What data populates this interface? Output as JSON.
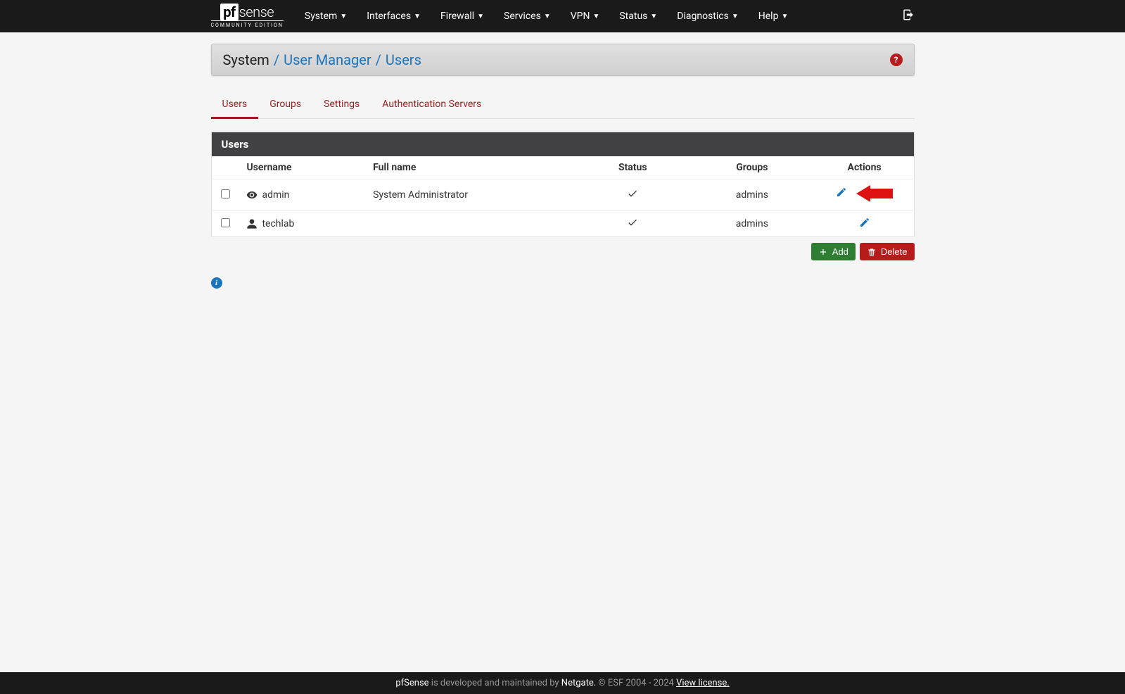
{
  "logo": {
    "brand": "sense",
    "prefix": "pf",
    "subtitle": "COMMUNITY EDITION"
  },
  "nav": {
    "items": [
      {
        "label": "System"
      },
      {
        "label": "Interfaces"
      },
      {
        "label": "Firewall"
      },
      {
        "label": "Services"
      },
      {
        "label": "VPN"
      },
      {
        "label": "Status"
      },
      {
        "label": "Diagnostics"
      },
      {
        "label": "Help"
      }
    ]
  },
  "breadcrumb": {
    "part1": "System",
    "part2": "User Manager",
    "part3": "Users",
    "sep": "/"
  },
  "tabs": [
    {
      "label": "Users",
      "active": true
    },
    {
      "label": "Groups",
      "active": false
    },
    {
      "label": "Settings",
      "active": false
    },
    {
      "label": "Authentication Servers",
      "active": false
    }
  ],
  "panel": {
    "title": "Users",
    "headers": {
      "username": "Username",
      "fullname": "Full name",
      "status": "Status",
      "groups": "Groups",
      "actions": "Actions"
    },
    "rows": [
      {
        "username": "admin",
        "fullname": "System Administrator",
        "status": true,
        "groups": "admins",
        "icon": "eye",
        "highlight_arrow": true
      },
      {
        "username": "techlab",
        "fullname": "",
        "status": true,
        "groups": "admins",
        "icon": "user",
        "highlight_arrow": false
      }
    ]
  },
  "buttons": {
    "add": "Add",
    "delete": "Delete"
  },
  "footer": {
    "brand": "pfSense",
    "text1": " is developed and maintained by ",
    "netgate": "Netgate.",
    "text2": " © ESF 2004 - 2024 ",
    "license": "View license."
  }
}
